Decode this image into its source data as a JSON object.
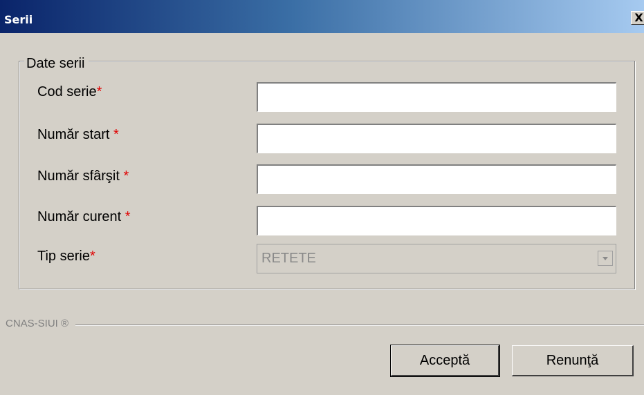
{
  "window": {
    "title": "Serii",
    "close_label": "X"
  },
  "group": {
    "legend": "Date serii"
  },
  "fields": [
    {
      "label": "Cod serie",
      "required_mark": "*",
      "value": ""
    },
    {
      "label": "Număr start",
      "required_mark": "*",
      "value": ""
    },
    {
      "label": "Număr sfârşit",
      "required_mark": "*",
      "value": ""
    },
    {
      "label": "Număr curent",
      "required_mark": "*",
      "value": ""
    }
  ],
  "tip_serie": {
    "label": "Tip serie",
    "required_mark": "*",
    "selected": "RETETE",
    "disabled": true
  },
  "footer": {
    "brand": "CNAS-SIUI ®"
  },
  "buttons": {
    "accept": "Acceptă",
    "cancel": "Renunţă"
  },
  "colors": {
    "title_start": "#0a246a",
    "title_end": "#a6caf0",
    "dialog_bg": "#d4d0c8",
    "required": "#e00000"
  }
}
